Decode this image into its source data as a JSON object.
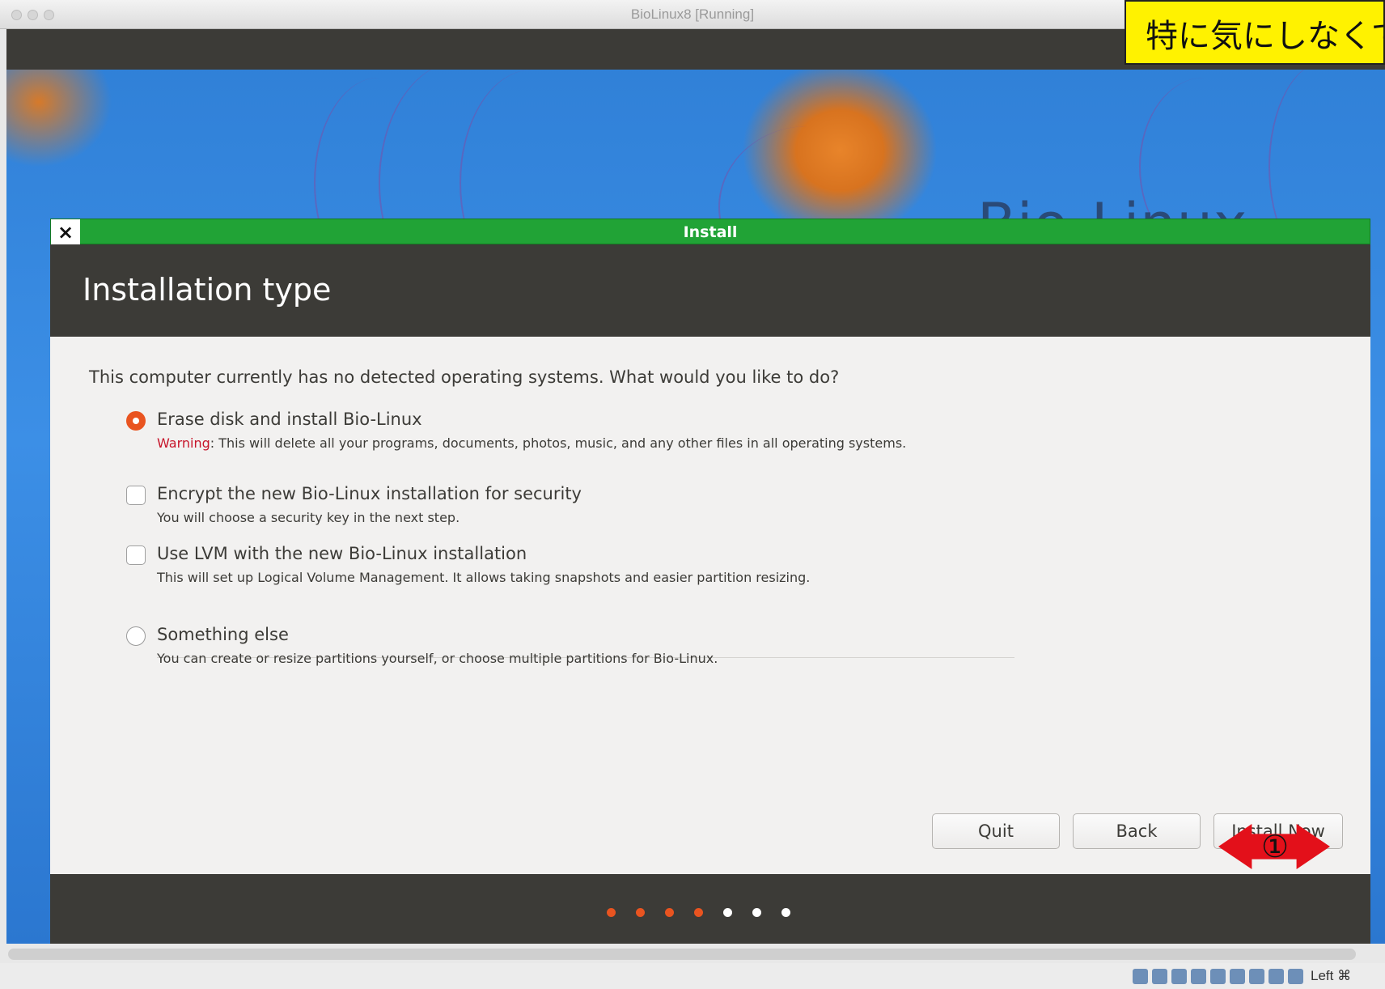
{
  "host_window": {
    "title": "BioLinux8 [Running]",
    "host_key_label": "Left ⌘"
  },
  "guest_desktop": {
    "brand_text": "Bio-Linux"
  },
  "installer": {
    "window_title": "Install",
    "close_icon": "×",
    "header_title": "Installation type",
    "question": "This computer currently has no detected operating systems. What would you like to do?",
    "options": [
      {
        "type": "radio",
        "selected": true,
        "label": "Erase disk and install Bio-Linux",
        "warning_prefix": "Warning",
        "description": ": This will delete all your programs, documents, photos, music, and any other files in all operating systems."
      },
      {
        "type": "checkbox",
        "checked": false,
        "label": "Encrypt the new Bio-Linux installation for security",
        "description": "You will choose a security key in the next step."
      },
      {
        "type": "checkbox",
        "checked": false,
        "label": "Use LVM with the new Bio-Linux installation",
        "description": "This will set up Logical Volume Management. It allows taking snapshots and easier partition resizing."
      },
      {
        "type": "radio",
        "selected": false,
        "label": "Something else",
        "description": "You can create or resize partitions yourself, or choose multiple partitions for Bio-Linux."
      }
    ],
    "buttons": {
      "quit": "Quit",
      "back": "Back",
      "install_now": "Install Now"
    },
    "progress": {
      "total_steps": 7,
      "completed_steps": 4
    }
  },
  "annotations": {
    "callout_text": "特に気にしなくて",
    "arrow_number": "①"
  },
  "colors": {
    "accent_orange": "#e95420",
    "title_green": "#21a336",
    "dark_band": "#3c3b37",
    "warning_red": "#c7162b",
    "callout_yellow": "#fff200",
    "arrow_red": "#e3101a"
  }
}
